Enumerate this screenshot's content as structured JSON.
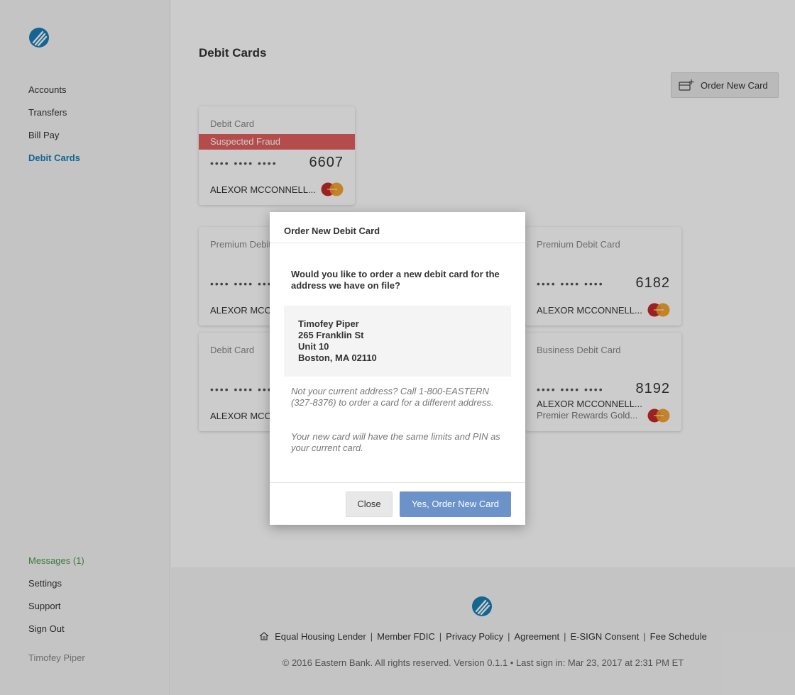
{
  "brand": {
    "accent": "#1b7fb7",
    "fraud_color": "#e35f5f",
    "primary_button": "#6b93c9",
    "messages_color": "#4a9a48"
  },
  "sidebar": {
    "nav": [
      {
        "label": "Accounts"
      },
      {
        "label": "Transfers"
      },
      {
        "label": "Bill Pay"
      },
      {
        "label": "Debit Cards",
        "active": true
      }
    ],
    "bottom": [
      {
        "label": "Messages (1)"
      },
      {
        "label": "Settings"
      },
      {
        "label": "Support"
      },
      {
        "label": "Sign Out"
      }
    ],
    "user_name": "Timofey Piper"
  },
  "main": {
    "title": "Debit Cards",
    "order_button": "Order New Card",
    "cards": [
      {
        "type": "Debit Card",
        "status": "Suspected Fraud",
        "dots": "•••• •••• ••••",
        "last4": "6607",
        "holder": "ALEXOR MCCONNELL..."
      },
      {
        "type": "Premium Debit Card",
        "dots": "•••• •••• ••••",
        "last4": "",
        "holder": "ALEXOR MCCONNELL..."
      },
      {
        "type": "Premium Debit Card",
        "dots": "•••• •••• ••••",
        "last4": "6182",
        "holder": "ALEXOR MCCONNELL..."
      },
      {
        "type": "Debit Card",
        "dots": "•••• •••• ••••",
        "last4": "",
        "holder": "ALEXOR MCCONNELL..."
      },
      {
        "type": "Business Debit Card",
        "dots": "•••• •••• ••••",
        "last4": "8192",
        "holder": "ALEXOR MCCONNELL...",
        "sub": "Premier Rewards Gold..."
      }
    ]
  },
  "modal": {
    "title": "Order New Debit Card",
    "question": "Would you like to order a new debit card for the address we have on file?",
    "address": {
      "line1": "Timofey Piper",
      "line2": "265 Franklin St",
      "line3": "Unit 10",
      "line4": "Boston, MA 02110"
    },
    "note1": "Not your current address? Call 1-800-EASTERN (327-8376) to order a card for a different address.",
    "note2": "Your new card will have the same limits and PIN as your current card.",
    "close_label": "Close",
    "confirm_label": "Yes, Order New Card"
  },
  "footer": {
    "links": [
      "Equal Housing Lender",
      "Member FDIC",
      "Privacy Policy",
      "Agreement",
      "E-SIGN Consent",
      "Fee Schedule"
    ],
    "separator": "|",
    "copyright": "© 2016 Eastern Bank. All rights reserved. Version 0.1.1 • Last sign in: Mar 23, 2017 at 2:31 PM ET"
  }
}
